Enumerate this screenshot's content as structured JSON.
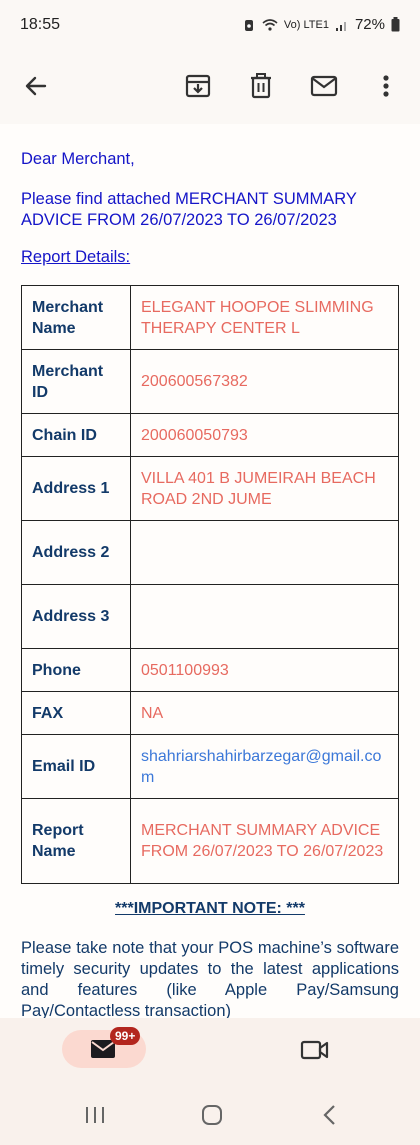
{
  "status_bar": {
    "time": "18:55",
    "network_label": "Vo) LTE1",
    "battery": "72%"
  },
  "app_bar": {
    "icons": [
      "back-arrow-icon",
      "archive-icon",
      "delete-icon",
      "mail-icon",
      "more-vert-icon"
    ]
  },
  "email": {
    "greeting": "Dear Merchant,",
    "intro": "Please find attached MERCHANT SUMMARY ADVICE FROM 26/07/2023 TO 26/07/2023",
    "report_link": "Report Details:",
    "details": [
      {
        "label": "Merchant Name",
        "value": "ELEGANT HOOPOE SLIMMING THERAPY CENTER L"
      },
      {
        "label": "Merchant ID",
        "value": "200600567382"
      },
      {
        "label": "Chain ID",
        "value": "200060050793"
      },
      {
        "label": "Address 1",
        "value": "VILLA 401 B JUMEIRAH BEACH ROAD 2ND JUME"
      },
      {
        "label": "Address 2",
        "value": ""
      },
      {
        "label": "Address 3",
        "value": ""
      },
      {
        "label": "Phone",
        "value": "0501100993"
      },
      {
        "label": "FAX",
        "value": "NA"
      },
      {
        "label": "Email ID",
        "value": "shahriarshahirbarzegar@gmail.com"
      },
      {
        "label": "Report Name",
        "value": "MERCHANT SUMMARY ADVICE FROM 26/07/2023 TO 26/07/2023"
      }
    ],
    "note_title": "***IMPORTANT NOTE: ***",
    "note_body": "Please take note that your POS machine’s software timely security updates to the latest applications and features (like Apple Pay/Samsung Pay/Contactless transaction)"
  },
  "bottom_nav": {
    "mail_badge": "99+"
  },
  "colors": {
    "link_blue": "#1515c8",
    "label_navy": "#133a69",
    "value_red": "#e76a60",
    "email_blue": "#3c78d8",
    "badge_red": "#b3261e"
  }
}
